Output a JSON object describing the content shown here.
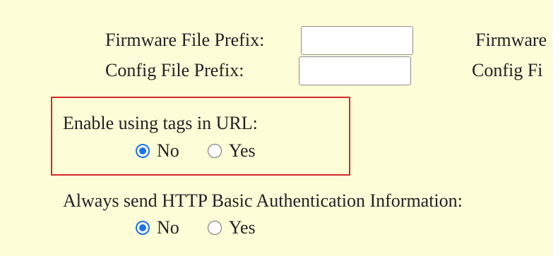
{
  "firmware_prefix": {
    "label": "Firmware File Prefix:",
    "value": ""
  },
  "config_prefix": {
    "label": "Config File Prefix:",
    "value": ""
  },
  "right_column": {
    "firmware_label_partial": "Firmware",
    "config_label_partial": "Config Fi"
  },
  "tags_in_url": {
    "label": "Enable using tags in URL:",
    "options": [
      {
        "label": "No",
        "selected": true
      },
      {
        "label": "Yes",
        "selected": false
      }
    ]
  },
  "http_basic_auth": {
    "label": "Always send HTTP Basic Authentication Information:",
    "options": [
      {
        "label": "No",
        "selected": true
      },
      {
        "label": "Yes",
        "selected": false
      }
    ]
  },
  "colors": {
    "background": "#fdfdd8",
    "highlight_border": "#d42a2a",
    "radio_accent": "#1a73e8"
  }
}
